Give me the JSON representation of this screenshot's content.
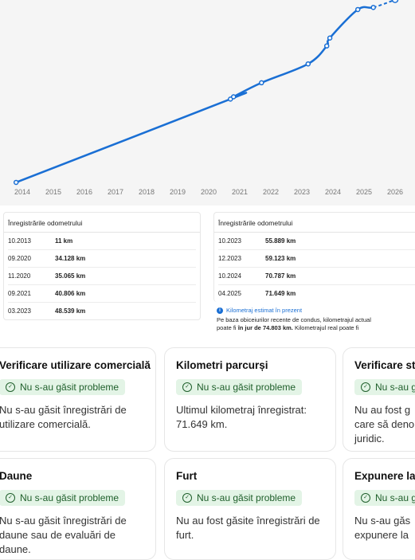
{
  "chart_data": {
    "type": "line",
    "title": "",
    "xlabel": "",
    "ylabel": "",
    "x_ticks": [
      "2014",
      "2015",
      "2016",
      "2017",
      "2018",
      "2019",
      "2020",
      "2021",
      "2022",
      "2023",
      "2024",
      "2025",
      "2026"
    ],
    "series": [
      {
        "points": [
          {
            "x": 2013.8,
            "y": 11
          },
          {
            "x": 2020.7,
            "y": 34128
          },
          {
            "x": 2020.8,
            "y": 35065
          },
          {
            "x": 2021.7,
            "y": 40806
          },
          {
            "x": 2023.2,
            "y": 48539
          },
          {
            "x": 2023.8,
            "y": 55889
          },
          {
            "x": 2023.9,
            "y": 59123
          },
          {
            "x": 2024.8,
            "y": 70787
          },
          {
            "x": 2025.3,
            "y": 71649
          },
          {
            "x": 2026.0,
            "y": 74803
          }
        ],
        "color": "#1a6fd4"
      }
    ]
  },
  "tables": {
    "left": {
      "header": "Înregistrările odometrului",
      "rows": [
        {
          "date": "10.2013",
          "km": "11 km"
        },
        {
          "date": "09.2020",
          "km": "34.128 km"
        },
        {
          "date": "11.2020",
          "km": "35.065 km"
        },
        {
          "date": "09.2021",
          "km": "40.806 km"
        },
        {
          "date": "03.2023",
          "km": "48.539 km"
        }
      ]
    },
    "right": {
      "header": "Înregistrările odometrului",
      "rows": [
        {
          "date": "10.2023",
          "km": "55.889 km"
        },
        {
          "date": "12.2023",
          "km": "59.123 km"
        },
        {
          "date": "10.2024",
          "km": "70.787 km"
        },
        {
          "date": "04.2025",
          "km": "71.649 km"
        }
      ]
    },
    "estimate_link": "Kilometraj estimat în prezent",
    "estimate_text_1": "Pe baza obiceiurilor recente de condus, kilometrajul actual",
    "estimate_text_2a": "poate fi ",
    "estimate_text_2b": "în jur de 74.803 km.",
    "estimate_text_2c": " Kilometrajul real poate fi"
  },
  "cards": [
    {
      "title": "Verificare utilizare comercială",
      "badge": "Nu s-au găsit probleme",
      "text": "Nu s-au găsit înregistrări de utilizare comercială."
    },
    {
      "title": "Kilometri parcurși",
      "badge": "Nu s-au găsit probleme",
      "text": "Ultimul kilometraj înregistrat: 71.649 km."
    },
    {
      "title": "Verificare st",
      "badge": "Nu s-au g",
      "text": "Nu au fost g care să deno juridic."
    },
    {
      "title": "Daune",
      "badge": "Nu s-au găsit probleme",
      "text": "Nu s-au găsit înregistrări de daune sau de evaluări de daune."
    },
    {
      "title": "Furt",
      "badge": "Nu s-au găsit probleme",
      "text": "Nu au fost găsite înregistrări de furt."
    },
    {
      "title": "Expunere la",
      "badge": "Nu s-au g",
      "text": "Nu s-au găs expunere la"
    }
  ],
  "colors": {
    "line": "#1a6fd4",
    "badge_bg": "#e3f4e6",
    "badge_text": "#1f5f2b"
  }
}
